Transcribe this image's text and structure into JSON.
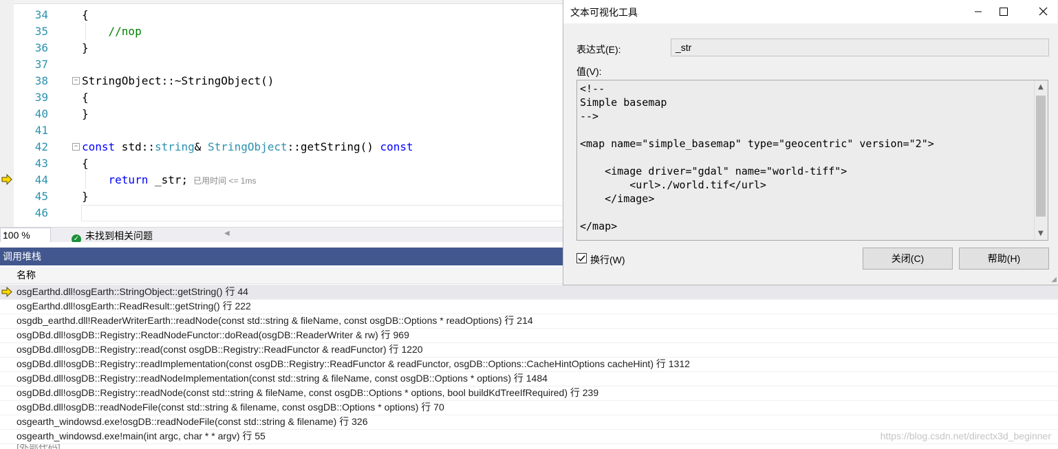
{
  "editor": {
    "lines": [
      {
        "num": "34",
        "segments": [
          {
            "t": "{",
            "c": ""
          }
        ]
      },
      {
        "num": "35",
        "segments": [
          {
            "t": "    ",
            "c": ""
          },
          {
            "t": "//nop",
            "c": "cm"
          }
        ]
      },
      {
        "num": "36",
        "segments": [
          {
            "t": "}",
            "c": ""
          }
        ]
      },
      {
        "num": "37",
        "segments": []
      },
      {
        "num": "38",
        "segments": [
          {
            "t": "StringObject::~StringObject()",
            "c": ""
          }
        ]
      },
      {
        "num": "39",
        "segments": [
          {
            "t": "{",
            "c": ""
          }
        ]
      },
      {
        "num": "40",
        "segments": [
          {
            "t": "}",
            "c": ""
          }
        ]
      },
      {
        "num": "41",
        "segments": []
      },
      {
        "num": "42",
        "segments": [
          {
            "t": "const",
            "c": "kw"
          },
          {
            "t": " std::",
            "c": ""
          },
          {
            "t": "string",
            "c": "tp"
          },
          {
            "t": "& ",
            "c": ""
          },
          {
            "t": "StringObject",
            "c": "tp"
          },
          {
            "t": "::getString() ",
            "c": ""
          },
          {
            "t": "const",
            "c": "kw"
          }
        ]
      },
      {
        "num": "43",
        "segments": [
          {
            "t": "{",
            "c": ""
          }
        ]
      },
      {
        "num": "44",
        "segments": [
          {
            "t": "    ",
            "c": ""
          },
          {
            "t": "return",
            "c": "kw"
          },
          {
            "t": " _str;",
            "c": ""
          }
        ],
        "hint": "已用时间 <= 1ms"
      },
      {
        "num": "45",
        "segments": [
          {
            "t": "}",
            "c": ""
          }
        ]
      },
      {
        "num": "46",
        "segments": []
      }
    ]
  },
  "statusbar": {
    "zoom": "100 %",
    "issues": "未找到相关问题"
  },
  "callstack": {
    "title": "调用堆栈",
    "column_name": "名称",
    "rows": [
      "osgEarthd.dll!osgEarth::StringObject::getString() 行 44",
      "osgEarthd.dll!osgEarth::ReadResult::getString() 行 222",
      "osgdb_earthd.dll!ReaderWriterEarth::readNode(const std::string & fileName, const osgDB::Options * readOptions) 行 214",
      "osgDBd.dll!osgDB::Registry::ReadNodeFunctor::doRead(osgDB::ReaderWriter & rw) 行 969",
      "osgDBd.dll!osgDB::Registry::read(const osgDB::Registry::ReadFunctor & readFunctor) 行 1220",
      "osgDBd.dll!osgDB::Registry::readImplementation(const osgDB::Registry::ReadFunctor & readFunctor, osgDB::Options::CacheHintOptions cacheHint) 行 1312",
      "osgDBd.dll!osgDB::Registry::readNodeImplementation(const std::string & fileName, const osgDB::Options * options) 行 1484",
      "osgDBd.dll!osgDB::Registry::readNode(const std::string & fileName, const osgDB::Options * options, bool buildKdTreeIfRequired) 行 239",
      "osgDBd.dll!osgDB::readNodeFile(const std::string & filename, const osgDB::Options * options) 行 70",
      "osgearth_windowsd.exe!osgDB::readNodeFile(const std::string & filename) 行 326",
      "osgearth_windowsd.exe!main(int argc, char * * argv) 行 55"
    ],
    "partial_row": "[外部代码]",
    "watermark": "https://blog.csdn.net/directx3d_beginner"
  },
  "dialog": {
    "title": "文本可视化工具",
    "expression_label": "表达式(E):",
    "expression_value": "_str",
    "value_label": "值(V):",
    "value_text": "<!--\nSimple basemap\n-->\n\n<map name=\"simple_basemap\" type=\"geocentric\" version=\"2\">\n\n    <image driver=\"gdal\" name=\"world-tiff\">\n        <url>./world.tif</url>\n    </image>\n\n</map>",
    "wrap_label": "换行(W)",
    "wrap_checked": true,
    "close_button": "关闭(C)",
    "help_button": "帮助(H)"
  }
}
